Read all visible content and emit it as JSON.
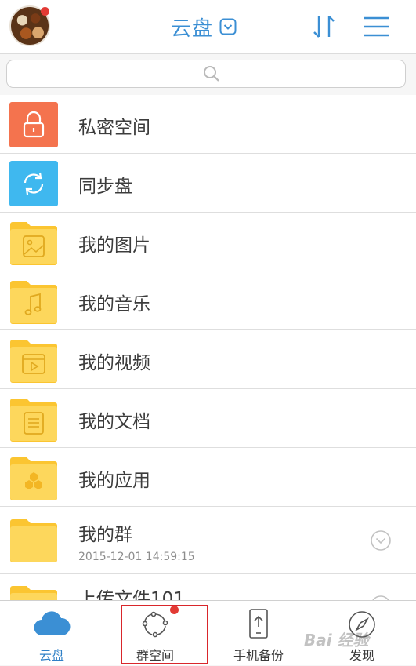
{
  "header": {
    "title": "云盘",
    "avatar_icon": "avatar-icon",
    "title_chevron_icon": "chevron-down-icon",
    "sort_icon": "sort-icon",
    "menu_icon": "menu-icon",
    "accent_color": "#3b8fd4",
    "notification_dot_color": "#e23a34"
  },
  "search": {
    "placeholder": "",
    "value": "",
    "icon": "search-icon"
  },
  "folders": [
    {
      "label": "私密空间",
      "icon": "lock-icon",
      "color": "#f4734e"
    },
    {
      "label": "同步盘",
      "icon": "sync-icon",
      "color": "#3fb8ef"
    },
    {
      "label": "我的图片",
      "icon": "image-folder-icon",
      "color": "#fcd34c"
    },
    {
      "label": "我的音乐",
      "icon": "music-folder-icon",
      "color": "#fcd34c"
    },
    {
      "label": "我的视频",
      "icon": "video-folder-icon",
      "color": "#fcd34c"
    },
    {
      "label": "我的文档",
      "icon": "document-folder-icon",
      "color": "#fcd34c"
    },
    {
      "label": "我的应用",
      "icon": "app-folder-icon",
      "color": "#fcd34c"
    },
    {
      "label": "我的群",
      "icon": "folder-icon",
      "date": "2015-12-01 14:59:15",
      "expand_icon": "chevron-down-circle-icon"
    },
    {
      "label": "上传文件101",
      "icon": "folder-icon",
      "expand_icon": "chevron-down-circle-icon"
    }
  ],
  "tabs": [
    {
      "label": "云盘",
      "icon": "cloud-icon",
      "active": true
    },
    {
      "label": "群空间",
      "icon": "group-space-icon",
      "badge": true
    },
    {
      "label": "手机备份",
      "icon": "phone-backup-icon"
    },
    {
      "label": "发现",
      "icon": "compass-icon"
    }
  ],
  "highlight_color": "#d9262b",
  "watermark": "Bai 经验"
}
